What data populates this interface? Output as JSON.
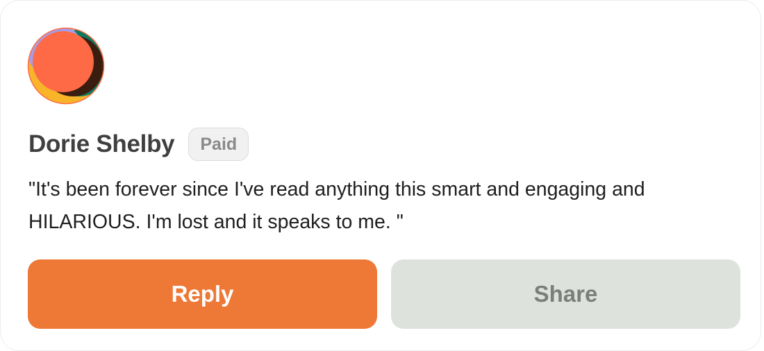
{
  "comment": {
    "author_name": "Dorie Shelby",
    "badge": "Paid",
    "quote": "\"It's been forever since I've read anything this smart and engaging and HILARIOUS. I'm lost and it speaks to me. \""
  },
  "actions": {
    "reply_label": "Reply",
    "share_label": "Share"
  },
  "colors": {
    "reply_button": "#ee7836",
    "share_button": "#dde3dc",
    "avatar_orange": "#fe6a45",
    "avatar_green": "#0d7a5f",
    "avatar_yellow": "#f8b52a",
    "avatar_lavender": "#a59ee6"
  }
}
